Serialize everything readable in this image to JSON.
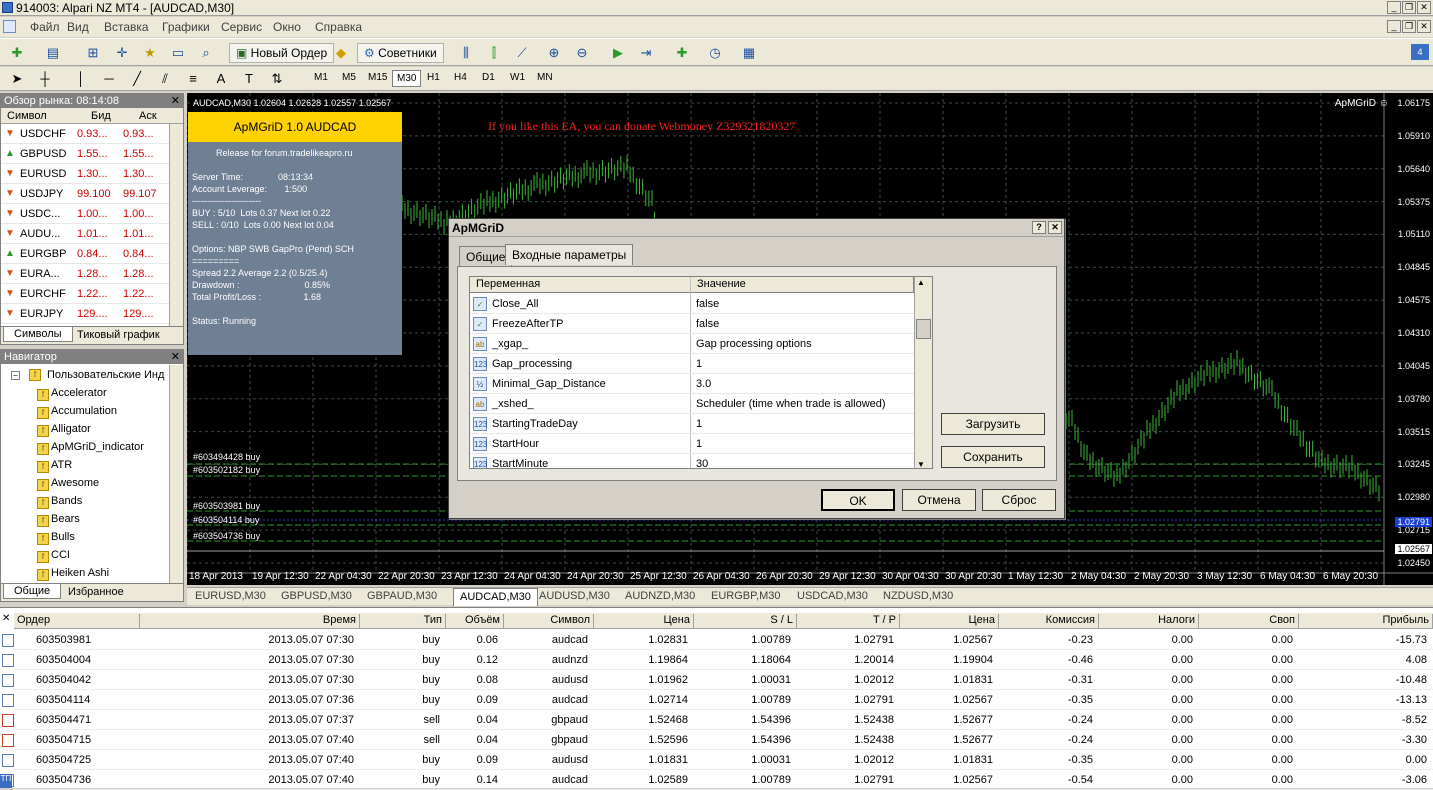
{
  "window": {
    "title": "914003: Alpari NZ MT4 - [AUDCAD,M30]"
  },
  "menu": [
    "Файл",
    "Вид",
    "Вставка",
    "Графики",
    "Сервис",
    "Окно",
    "Справка"
  ],
  "toolbar": {
    "new_order": "Новый Ордер",
    "experts": "Советники"
  },
  "timeframes": [
    "M1",
    "M5",
    "M15",
    "M30",
    "H1",
    "H4",
    "D1",
    "W1",
    "MN"
  ],
  "active_timeframe": "M30",
  "market_watch": {
    "title": "Обзор рынка: 08:14:08",
    "columns": [
      "Символ",
      "Бид",
      "Аск"
    ],
    "rows": [
      {
        "symbol": "USDCHF",
        "bid": "0.93...",
        "ask": "0.93...",
        "dir": "down"
      },
      {
        "symbol": "GBPUSD",
        "bid": "1.55...",
        "ask": "1.55...",
        "dir": "up"
      },
      {
        "symbol": "EURUSD",
        "bid": "1.30...",
        "ask": "1.30...",
        "dir": "down"
      },
      {
        "symbol": "USDJPY",
        "bid": "99.100",
        "ask": "99.107",
        "dir": "down"
      },
      {
        "symbol": "USDC...",
        "bid": "1.00...",
        "ask": "1.00...",
        "dir": "down"
      },
      {
        "symbol": "AUDU...",
        "bid": "1.01...",
        "ask": "1.01...",
        "dir": "down"
      },
      {
        "symbol": "EURGBP",
        "bid": "0.84...",
        "ask": "0.84...",
        "dir": "up"
      },
      {
        "symbol": "EURA...",
        "bid": "1.28...",
        "ask": "1.28...",
        "dir": "down"
      },
      {
        "symbol": "EURCHF",
        "bid": "1.22...",
        "ask": "1.22...",
        "dir": "down"
      },
      {
        "symbol": "EURJPY",
        "bid": "129....",
        "ask": "129....",
        "dir": "down"
      }
    ],
    "tabs": [
      "Символы",
      "Тиковый график"
    ]
  },
  "navigator": {
    "title": "Навигатор",
    "root": "Пользовательские Инд",
    "items": [
      "Accelerator",
      "Accumulation",
      "Alligator",
      "ApMGriD_indicator",
      "ATR",
      "Awesome",
      "Bands",
      "Bears",
      "Bulls",
      "CCI",
      "Heiken Ashi"
    ],
    "tabs": [
      "Общие",
      "Избранное"
    ]
  },
  "chart": {
    "header": "AUDCAD,M30  1.02604 1.02628 1.02557 1.02567",
    "ea_label": "ApMGriD",
    "donate_text": "If you like this EA, you can donate Webmoney Z329321820327",
    "y_ticks": [
      "1.06175",
      "1.05910",
      "1.05640",
      "1.05375",
      "1.05110",
      "1.04845",
      "1.04575",
      "1.04310",
      "1.04045",
      "1.03780",
      "1.03515",
      "1.03245",
      "1.02980",
      "1.02715",
      "1.02450"
    ],
    "price_boxes": [
      "1.02791",
      "1.02567"
    ],
    "x_ticks": [
      "18 Apr 2013",
      "19 Apr 12:30",
      "22 Apr 04:30",
      "22 Apr 20:30",
      "23 Apr 12:30",
      "24 Apr 04:30",
      "24 Apr 20:30",
      "25 Apr 12:30",
      "26 Apr 04:30",
      "26 Apr 20:30",
      "29 Apr 12:30",
      "30 Apr 04:30",
      "30 Apr 20:30",
      "1 May 12:30",
      "2 May 04:30",
      "2 May 20:30",
      "3 May 12:30",
      "6 May 04:30",
      "6 May 20:30"
    ],
    "order_labels": [
      "#603494428 buy",
      "#603502182 buy",
      "#603503981 buy",
      "#603504114 buy",
      "#603504736 buy"
    ]
  },
  "info_panel": {
    "header": "ApMGriD 1.0 AUDCAD",
    "release": "Release for forum.tradelikeapro.ru",
    "lines": [
      "Server Time:              08:13:34",
      "Account Leverage:       1:500",
      "-----------------------",
      "BUY : 5/10  Lots 0.37 Next lot 0.22",
      "SELL : 0/10  Lots 0.00 Next lot 0.04",
      "",
      "Options: NBP SWB GapPro (Pend) SCH",
      "=========",
      "Spread 2.2 Average 2.2 (0.5/25.4)",
      "Drawdown :                          0.85%",
      "Total Profit/Loss :                 1.68",
      "",
      "Status: Running"
    ]
  },
  "chart_tabs": [
    "EURUSD,M30",
    "GBPUSD,M30",
    "GBPAUD,M30",
    "AUDCAD,M30",
    "AUDUSD,M30",
    "AUDNZD,M30",
    "EURGBP,M30",
    "USDCAD,M30",
    "NZDUSD,M30"
  ],
  "active_chart_tab": "AUDCAD,M30",
  "dialog": {
    "title": "ApMGriD",
    "help": "?",
    "close": "✕",
    "tabs": [
      "Общие",
      "Входные параметры"
    ],
    "columns": [
      "Переменная",
      "Значение"
    ],
    "params": [
      {
        "name": "Close_All",
        "value": "false",
        "icon": "bool"
      },
      {
        "name": "FreezeAfterTP",
        "value": "false",
        "icon": "bool"
      },
      {
        "name": "_xgap_",
        "value": "Gap processing options",
        "icon": "ab"
      },
      {
        "name": "Gap_processing",
        "value": "1",
        "icon": "123"
      },
      {
        "name": "Minimal_Gap_Distance",
        "value": "3.0",
        "icon": "1/2"
      },
      {
        "name": "_xshed_",
        "value": "Scheduler (time when trade is allowed)",
        "icon": "ab"
      },
      {
        "name": "StartingTradeDay",
        "value": "1",
        "icon": "123"
      },
      {
        "name": "StartHour",
        "value": "1",
        "icon": "123"
      },
      {
        "name": "StartMinute",
        "value": "30",
        "icon": "123"
      }
    ],
    "load": "Загрузить",
    "save": "Сохранить",
    "ok": "OK",
    "cancel": "Отмена",
    "reset": "Сброс"
  },
  "terminal": {
    "columns": [
      "Ордер",
      "Время",
      "Тип",
      "Объём",
      "Символ",
      "Цена",
      "S / L",
      "T / P",
      "Цена",
      "Комиссия",
      "Налоги",
      "Своп",
      "Прибыль"
    ],
    "rows": [
      [
        "603503981",
        "2013.05.07 07:30",
        "buy",
        "0.06",
        "audcad",
        "1.02831",
        "1.00789",
        "1.02791",
        "1.02567",
        "-0.23",
        "0.00",
        "0.00",
        "-15.73"
      ],
      [
        "603504004",
        "2013.05.07 07:30",
        "buy",
        "0.12",
        "audnzd",
        "1.19864",
        "1.18064",
        "1.20014",
        "1.19904",
        "-0.46",
        "0.00",
        "0.00",
        "4.08"
      ],
      [
        "603504042",
        "2013.05.07 07:30",
        "buy",
        "0.08",
        "audusd",
        "1.01962",
        "1.00031",
        "1.02012",
        "1.01831",
        "-0.31",
        "0.00",
        "0.00",
        "-10.48"
      ],
      [
        "603504114",
        "2013.05.07 07:36",
        "buy",
        "0.09",
        "audcad",
        "1.02714",
        "1.00789",
        "1.02791",
        "1.02567",
        "-0.35",
        "0.00",
        "0.00",
        "-13.13"
      ],
      [
        "603504471",
        "2013.05.07 07:37",
        "sell",
        "0.04",
        "gbpaud",
        "1.52468",
        "1.54396",
        "1.52438",
        "1.52677",
        "-0.24",
        "0.00",
        "0.00",
        "-8.52"
      ],
      [
        "603504715",
        "2013.05.07 07:40",
        "sell",
        "0.04",
        "gbpaud",
        "1.52596",
        "1.54396",
        "1.52438",
        "1.52677",
        "-0.24",
        "0.00",
        "0.00",
        "-3.30"
      ],
      [
        "603504725",
        "2013.05.07 07:40",
        "buy",
        "0.09",
        "audusd",
        "1.01831",
        "1.00031",
        "1.02012",
        "1.01831",
        "-0.35",
        "0.00",
        "0.00",
        "0.00"
      ],
      [
        "603504736",
        "2013.05.07 07:40",
        "buy",
        "0.14",
        "audcad",
        "1.02589",
        "1.00789",
        "1.02791",
        "1.02567",
        "-0.54",
        "0.00",
        "0.00",
        "-3.06"
      ]
    ]
  },
  "colors": {
    "chart_bg": "#000000",
    "candle": "#3cb83c",
    "grid": "#5a6a6a",
    "info_bg": "#6f7f94",
    "info_header": "#ffd200",
    "donate": "#ff2020"
  }
}
